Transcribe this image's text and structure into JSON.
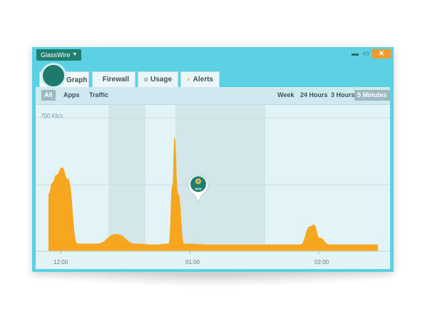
{
  "app": {
    "menu_label": "GlassWire"
  },
  "window_controls": {
    "minimize": "▬",
    "maximize": "▭",
    "close": "✕"
  },
  "tabs": [
    {
      "label": "Graph",
      "icon": "logo",
      "active": true
    },
    {
      "label": "Firewall",
      "icon": "flame-icon"
    },
    {
      "label": "Usage",
      "icon": "gauge-icon"
    },
    {
      "label": "Alerts",
      "icon": "bulb-icon"
    }
  ],
  "filters": {
    "left": [
      "All",
      "Apps",
      "Traffic"
    ],
    "right": [
      "Week",
      "24 Hours",
      "3 Hours",
      "5 Minutes"
    ],
    "selected_left": "All",
    "selected_right": "5 Minutes"
  },
  "chart": {
    "y_label": "700 Kb/s",
    "x_labels": [
      "12:00",
      "01:00",
      "02:00"
    ],
    "pin_label": "NEW",
    "colors": {
      "fill": "#f6a61f",
      "bg": "#e3f4f8",
      "band": "#d3e6ea",
      "pin": "#1f7e6e"
    }
  },
  "chart_data": {
    "type": "area",
    "ylabel": "700 Kb/s",
    "x": [
      "11:55",
      "11:57",
      "11:59",
      "12:02",
      "12:05",
      "12:10",
      "12:20",
      "12:30",
      "12:40",
      "12:50",
      "12:57",
      "12:59",
      "01:00",
      "01:02",
      "01:05",
      "01:20",
      "01:40",
      "01:55",
      "02:05",
      "02:10",
      "02:12",
      "02:15",
      "02:20",
      "02:30",
      "02:40",
      "02:45"
    ],
    "series": [
      {
        "values": [
          300,
          360,
          400,
          440,
          380,
          40,
          40,
          90,
          40,
          35,
          40,
          350,
          600,
          300,
          40,
          35,
          35,
          35,
          35,
          130,
          140,
          70,
          35,
          35,
          35,
          35
        ]
      }
    ],
    "ylim": [
      0,
      700
    ],
    "grid": true
  }
}
